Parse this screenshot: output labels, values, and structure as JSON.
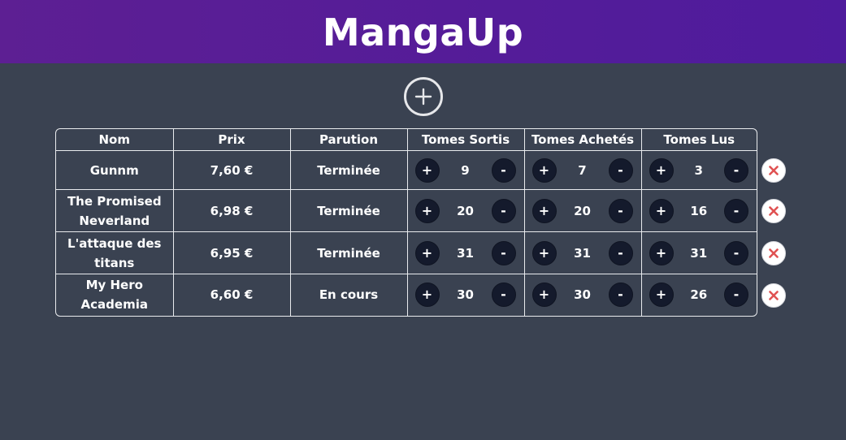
{
  "app": {
    "title": "MangaUp"
  },
  "table": {
    "headers": [
      "Nom",
      "Prix",
      "Parution",
      "Tomes Sortis",
      "Tomes Achetés",
      "Tomes Lus"
    ],
    "increment_label": "+",
    "decrement_label": "-",
    "rows": [
      {
        "nom": "Gunnm",
        "prix": "7,60 €",
        "parution": "Terminée",
        "sortis": "9",
        "achetes": "7",
        "lus": "3"
      },
      {
        "nom": "The Promised Neverland",
        "prix": "6,98 €",
        "parution": "Terminée",
        "sortis": "20",
        "achetes": "20",
        "lus": "16"
      },
      {
        "nom": "L'attaque des titans",
        "prix": "6,95 €",
        "parution": "Terminée",
        "sortis": "31",
        "achetes": "31",
        "lus": "31"
      },
      {
        "nom": "My Hero Academia",
        "prix": "6,60 €",
        "parution": "En cours",
        "sortis": "30",
        "achetes": "30",
        "lus": "26"
      }
    ]
  },
  "icons": {
    "add": "plus-circle-icon",
    "delete": "close-icon"
  },
  "colors": {
    "header_bg": "#541c99",
    "page_bg": "#3a4251",
    "stepper_bg": "#141a2c",
    "delete_x": "#e05252"
  }
}
